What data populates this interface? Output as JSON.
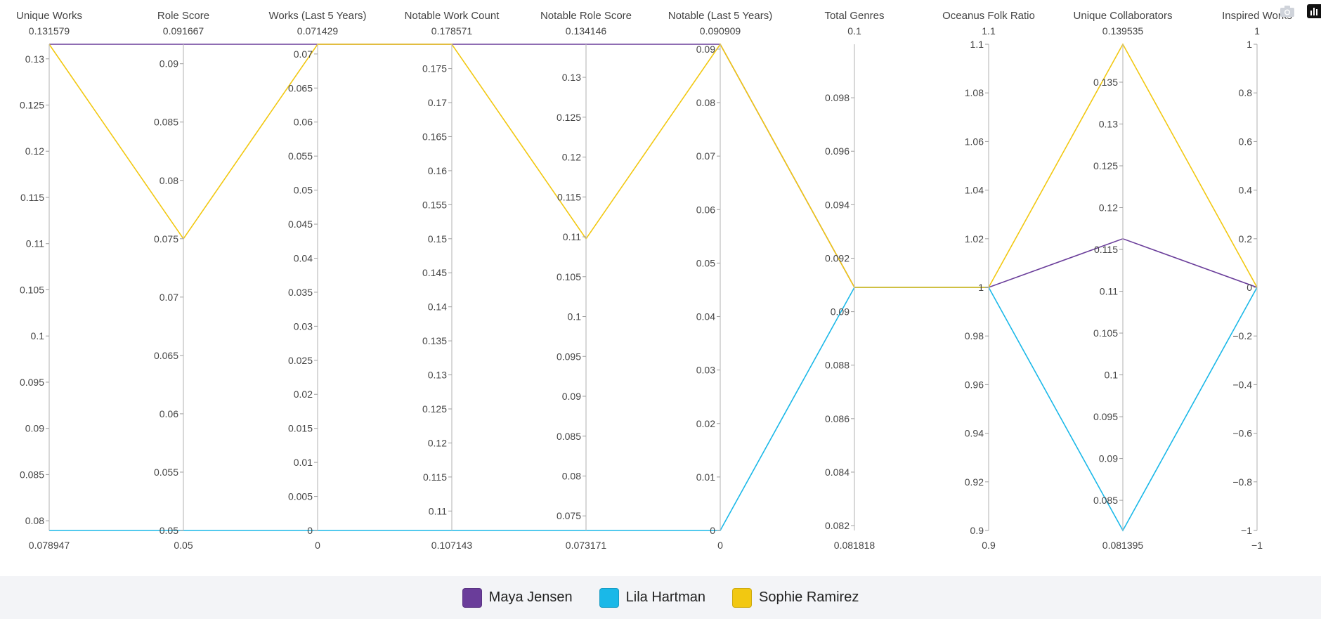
{
  "chart_data": {
    "type": "parallel_coordinates",
    "axes": [
      {
        "label": "Unique Works",
        "range": [
          0.078947,
          0.131579
        ],
        "top_label": "0.131579",
        "bottom_label": "0.078947",
        "ticks": [
          "0.13",
          "0.125",
          "0.12",
          "0.115",
          "0.11",
          "0.105",
          "0.1",
          "0.095",
          "0.09",
          "0.085",
          "0.08"
        ]
      },
      {
        "label": "Role Score",
        "range": [
          0.05,
          0.091667
        ],
        "top_label": "0.091667",
        "bottom_label": "0.05",
        "ticks": [
          "0.09",
          "0.085",
          "0.08",
          "0.075",
          "0.07",
          "0.065",
          "0.06",
          "0.055",
          "0.05"
        ]
      },
      {
        "label": "Works (Last 5 Years)",
        "range": [
          0,
          0.071429
        ],
        "top_label": "0.071429",
        "bottom_label": "0",
        "ticks": [
          "0.07",
          "0.065",
          "0.06",
          "0.055",
          "0.05",
          "0.045",
          "0.04",
          "0.035",
          "0.03",
          "0.025",
          "0.02",
          "0.015",
          "0.01",
          "0.005",
          "0"
        ]
      },
      {
        "label": "Notable Work Count",
        "range": [
          0.107143,
          0.178571
        ],
        "top_label": "0.178571",
        "bottom_label": "0.107143",
        "ticks": [
          "0.175",
          "0.17",
          "0.165",
          "0.16",
          "0.155",
          "0.15",
          "0.145",
          "0.14",
          "0.135",
          "0.13",
          "0.125",
          "0.12",
          "0.115",
          "0.11"
        ]
      },
      {
        "label": "Notable Role Score",
        "range": [
          0.073171,
          0.134146
        ],
        "top_label": "0.134146",
        "bottom_label": "0.073171",
        "ticks": [
          "0.13",
          "0.125",
          "0.12",
          "0.115",
          "0.11",
          "0.105",
          "0.1",
          "0.095",
          "0.09",
          "0.085",
          "0.08",
          "0.075"
        ]
      },
      {
        "label": "Notable (Last 5 Years)",
        "range": [
          0,
          0.090909
        ],
        "top_label": "0.090909",
        "bottom_label": "0",
        "ticks": [
          "0.09",
          "0.08",
          "0.07",
          "0.06",
          "0.05",
          "0.04",
          "0.03",
          "0.02",
          "0.01",
          "0"
        ]
      },
      {
        "label": "Total Genres",
        "range": [
          0.081818,
          0.1
        ],
        "top_label": "0.1",
        "bottom_label": "0.081818",
        "ticks": [
          "0.098",
          "0.096",
          "0.094",
          "0.092",
          "0.09",
          "0.088",
          "0.086",
          "0.084",
          "0.082"
        ]
      },
      {
        "label": "Oceanus Folk Ratio",
        "range": [
          0.9,
          1.1
        ],
        "top_label": "1.1",
        "bottom_label": "0.9",
        "ticks": [
          "1.1",
          "1.08",
          "1.06",
          "1.04",
          "1.02",
          "1",
          "0.98",
          "0.96",
          "0.94",
          "0.92",
          "0.9"
        ]
      },
      {
        "label": "Unique Collaborators",
        "range": [
          0.081395,
          0.139535
        ],
        "top_label": "0.139535",
        "bottom_label": "0.081395",
        "ticks": [
          "0.135",
          "0.13",
          "0.125",
          "0.12",
          "0.115",
          "0.11",
          "0.105",
          "0.1",
          "0.095",
          "0.09",
          "0.085"
        ]
      },
      {
        "label": "Inspired Works",
        "range": [
          -1,
          1
        ],
        "top_label": "1",
        "bottom_label": "−1",
        "ticks": [
          "1",
          "0.8",
          "0.6",
          "0.4",
          "0.2",
          "0",
          "−0.2",
          "−0.4",
          "−0.6",
          "−0.8",
          "−1"
        ]
      }
    ],
    "series": [
      {
        "name": "Maya Jensen",
        "color": "#6a3d9a",
        "values": [
          0.131579,
          0.091667,
          0.071429,
          0.178571,
          0.134146,
          0.090909,
          0.090909,
          1.0,
          0.116279,
          0
        ]
      },
      {
        "name": "Lila Hartman",
        "color": "#1ab8e8",
        "values": [
          0.078947,
          0.05,
          0,
          0.107143,
          0.073171,
          0,
          0.090909,
          1.0,
          0.081395,
          0
        ]
      },
      {
        "name": "Sophie Ramirez",
        "color": "#f2c811",
        "values": [
          0.131579,
          0.075,
          0.071429,
          0.178571,
          0.109756,
          0.090909,
          0.090909,
          1.0,
          0.139535,
          0
        ]
      }
    ]
  },
  "toolbar": {
    "camera_icon": "camera-icon",
    "bars_icon": "bar-chart-icon"
  }
}
